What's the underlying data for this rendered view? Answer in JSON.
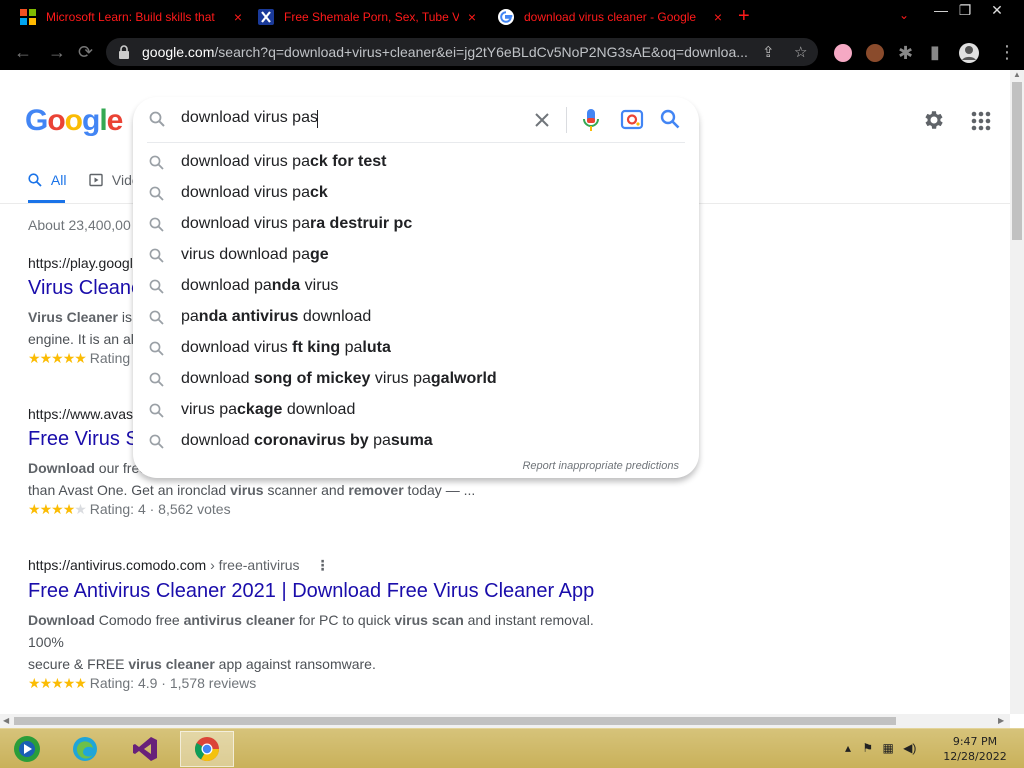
{
  "browser": {
    "tabs": [
      {
        "title": "Microsoft Learn: Build skills that",
        "close": "×"
      },
      {
        "title": "Free Shemale Porn, Sex, Tube Vi",
        "close": "×"
      },
      {
        "title": "download virus cleaner - Google S",
        "close": "×"
      }
    ],
    "new_tab": "+",
    "tab_search": "⌄",
    "url_domain": "google.com",
    "url_rest": "/search?q=download+virus+cleaner&ei=jg2tY6eBLdCv5NoP2NG3sAE&oq=downloa...",
    "window_controls": {
      "minimize": "—",
      "maximize": "❐",
      "close": "✕"
    }
  },
  "google": {
    "logo": [
      "G",
      "o",
      "o",
      "g",
      "l",
      "e"
    ],
    "search_value": "download virus pas",
    "tabs": {
      "all": "All",
      "videos": "Vide"
    },
    "result_stats": "About 23,400,00",
    "suggestions": [
      [
        {
          "t": "download virus pa",
          "b": false
        },
        {
          "t": "ck for test",
          "b": true
        }
      ],
      [
        {
          "t": "download virus pa",
          "b": false
        },
        {
          "t": "ck",
          "b": true
        }
      ],
      [
        {
          "t": "download virus pa",
          "b": false
        },
        {
          "t": "ra destruir pc",
          "b": true
        }
      ],
      [
        {
          "t": "virus download pa",
          "b": false
        },
        {
          "t": "ge",
          "b": true
        }
      ],
      [
        {
          "t": "download pa",
          "b": false
        },
        {
          "t": "nda",
          "b": true
        },
        {
          "t": " virus",
          "b": false
        }
      ],
      [
        {
          "t": "pa",
          "b": false
        },
        {
          "t": "nda antivirus",
          "b": true
        },
        {
          "t": " download",
          "b": false
        }
      ],
      [
        {
          "t": "download virus ",
          "b": false
        },
        {
          "t": "ft king",
          "b": true
        },
        {
          "t": " pa",
          "b": false
        },
        {
          "t": "luta",
          "b": true
        }
      ],
      [
        {
          "t": "download ",
          "b": false
        },
        {
          "t": "song of mickey",
          "b": true
        },
        {
          "t": " virus pa",
          "b": false
        },
        {
          "t": "galworld",
          "b": true
        }
      ],
      [
        {
          "t": "virus pa",
          "b": false
        },
        {
          "t": "ckage",
          "b": true
        },
        {
          "t": " download",
          "b": false
        }
      ],
      [
        {
          "t": "download ",
          "b": false
        },
        {
          "t": "coronavirus by",
          "b": true
        },
        {
          "t": " pa",
          "b": false
        },
        {
          "t": "suma",
          "b": true
        }
      ]
    ],
    "report": "Report inappropriate predictions",
    "results": [
      {
        "url": "https://play.googl",
        "title": "Virus Cleane",
        "snippet": [
          {
            "line": [
              {
                "t": "Virus Cleaner",
                "b": true
              },
              {
                "t": " is s",
                "b": false
              }
            ]
          },
          {
            "line": [
              {
                "t": "engine. It is an al",
                "b": false
              }
            ]
          }
        ],
        "stars": 4.5,
        "rating": "Rating"
      },
      {
        "url": "https://www.avas",
        "title": "Free Virus S",
        "snippet": [
          {
            "line": [
              {
                "t": "Download",
                "b": true
              },
              {
                "t": " our free",
                "b": false
              }
            ]
          },
          {
            "line": [
              {
                "t": "than Avast One. Get an ironclad ",
                "b": false
              },
              {
                "t": "virus",
                "b": true
              },
              {
                "t": " scanner and ",
                "b": false
              },
              {
                "t": "remover",
                "b": true
              },
              {
                "t": " today — ...",
                "b": false
              }
            ]
          }
        ],
        "stars": 4,
        "rating": "Rating: 4 · 8,562 votes"
      },
      {
        "url_host": "https://antivirus.comodo.com",
        "url_crumb": " › free-antivirus",
        "title": "Free Antivirus Cleaner 2021 | Download Free Virus Cleaner App",
        "snippet": [
          {
            "line": [
              {
                "t": "Download",
                "b": true
              },
              {
                "t": " Comodo free ",
                "b": false
              },
              {
                "t": "antivirus cleaner",
                "b": true
              },
              {
                "t": " for PC to quick ",
                "b": false
              },
              {
                "t": "virus scan",
                "b": true
              },
              {
                "t": " and instant removal. 100%",
                "b": false
              }
            ]
          },
          {
            "line": [
              {
                "t": "secure & FREE ",
                "b": false
              },
              {
                "t": "virus cleaner",
                "b": true
              },
              {
                "t": " app against ransomware.",
                "b": false
              }
            ]
          }
        ],
        "stars": 5,
        "rating": "Rating: 4.9 · 1,578 reviews"
      }
    ]
  },
  "taskbar": {
    "apps": [
      "windows-media-center",
      "edge",
      "visual-studio",
      "chrome"
    ],
    "time": "9:47 PM",
    "date": "12/28/2022"
  },
  "colors": {
    "accent": "#1a73e8",
    "link": "#1a0dab",
    "tab_text": "#ff1a1a",
    "taskbar": "#d6c37a"
  }
}
